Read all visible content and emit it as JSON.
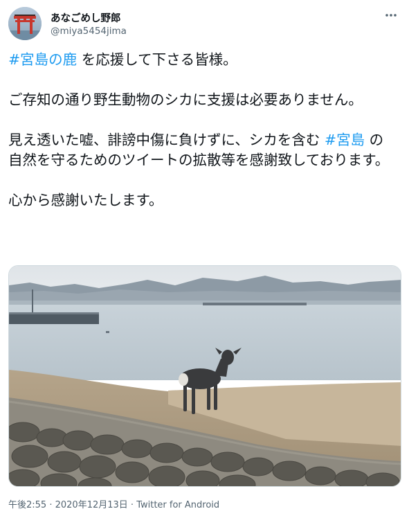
{
  "author": {
    "display_name": "あなごめし野郎",
    "handle": "@miya5454jima",
    "avatar_icon": "torii-gate-avatar"
  },
  "more_icon": "more-horizontal-icon",
  "tweet": {
    "p1_hashtag": "#宮島の鹿",
    "p1_text": " を応援して下さる皆様。",
    "p2_text": "ご存知の通り野生動物のシカに支援は必要ありません。",
    "p3_text_a": "見え透いた嘘、誹謗中傷に負けずに、シカを含む ",
    "p3_hashtag": "#宮島",
    "p3_text_b": " の自然を守るためのツイートの拡散等を感謝致しております。",
    "p4_text": "心から感謝いたします。"
  },
  "media": {
    "subject": "deer-on-seaside-path-photo"
  },
  "meta": {
    "time": "午後2:55",
    "separator1": " · ",
    "date": "2020年12月13日",
    "separator2": " · ",
    "source": "Twitter for Android"
  },
  "colors": {
    "link": "#1d9bf0",
    "secondary_text": "#536471",
    "border": "#cfd9de"
  }
}
